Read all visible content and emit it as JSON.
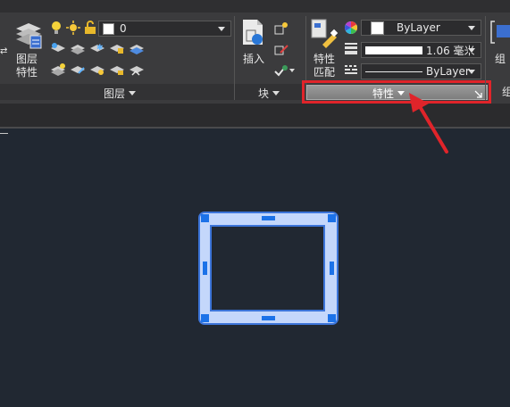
{
  "layers_panel": {
    "title": "图层",
    "layer_properties_label_line1": "图层",
    "layer_properties_label_line2": "特性",
    "current_layer": "0"
  },
  "block_panel": {
    "title": "块",
    "insert_label": "插入"
  },
  "properties_panel": {
    "title": "特性",
    "match_label_line1": "特性",
    "match_label_line2": "匹配",
    "color_value": "ByLayer",
    "lineweight_value": "1.06 毫米",
    "linetype_value": "ByLayer"
  },
  "group_panel": {
    "label_partial": "组"
  },
  "colors": {
    "canvas_bg": "#212832",
    "ribbon_bg": "#3b3b3d",
    "highlight_red": "#e0242a",
    "selection_blue": "#3c74d8",
    "grip_blue": "#1c72e8"
  }
}
